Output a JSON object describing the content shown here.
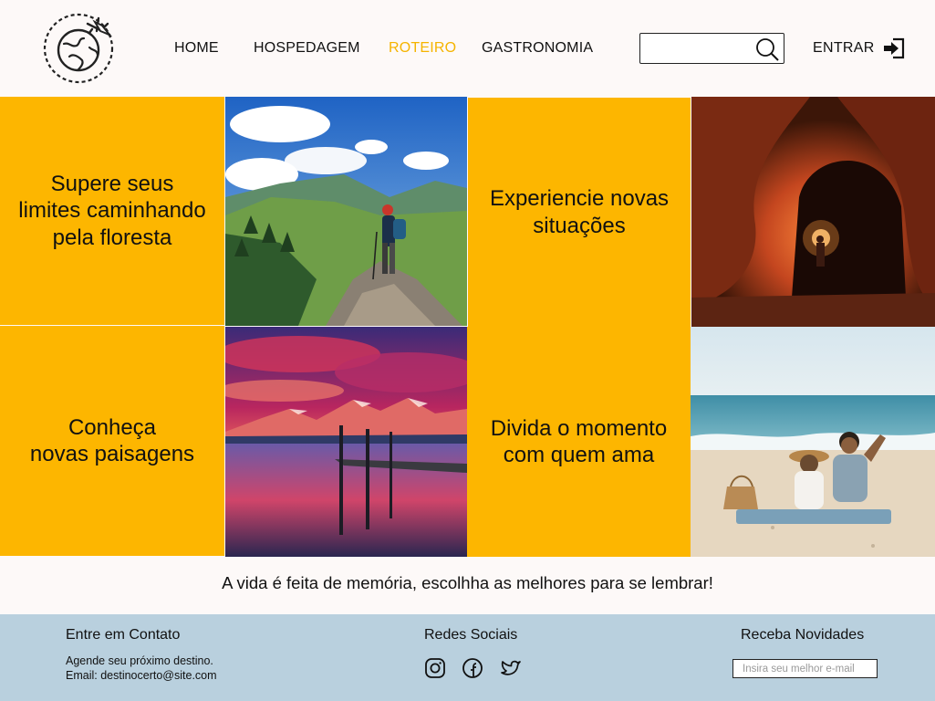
{
  "header": {
    "logo_icon": "globe-airplane-logo-icon",
    "nav": [
      {
        "label": "HOME",
        "active": false
      },
      {
        "label": "HOSPEDAGEM",
        "active": false
      },
      {
        "label": "ROTEIRO",
        "active": true
      },
      {
        "label": "GASTRONOMIA",
        "active": false
      }
    ],
    "search": {
      "value": "",
      "placeholder": "",
      "icon": "search-icon"
    },
    "login": {
      "label": "ENTRAR",
      "icon": "sign-in-icon"
    }
  },
  "colors": {
    "accent": "#fdb600",
    "active_nav": "#f5b400",
    "footer_bg": "#b9d0de",
    "page_bg": "#fdf9f8"
  },
  "grid": {
    "row1": [
      {
        "type": "text",
        "text_lines": [
          "Supere seus",
          "limites caminhando",
          "pela floresta"
        ]
      },
      {
        "type": "image",
        "image": "hiker-on-mountain-photo"
      },
      {
        "type": "text",
        "text_lines": [
          "Experiencie novas",
          "situações"
        ]
      },
      {
        "type": "image",
        "image": "person-with-torch-in-cave-photo"
      }
    ],
    "row2": [
      {
        "type": "text",
        "text_lines": [
          "Conheça",
          "novas paisagens"
        ]
      },
      {
        "type": "image",
        "image": "sunset-lake-pier-photo"
      },
      {
        "type": "text",
        "text_lines": [
          "Divida o momento",
          "com quem ama"
        ]
      },
      {
        "type": "image",
        "image": "couple-on-beach-photo"
      }
    ]
  },
  "tagline": "A vida é feita de memória, escolhha as melhores para se lembrar!",
  "footer": {
    "contact": {
      "title": "Entre em Contato",
      "line1": "Agende seu próximo destino.",
      "line2": "Email: destinocerto@site.com"
    },
    "social": {
      "title": "Redes Sociais",
      "icons": [
        "instagram-icon",
        "facebook-icon",
        "twitter-icon"
      ]
    },
    "newsletter": {
      "title": "Receba Novidades",
      "placeholder": "Insira seu melhor e-mail"
    }
  }
}
